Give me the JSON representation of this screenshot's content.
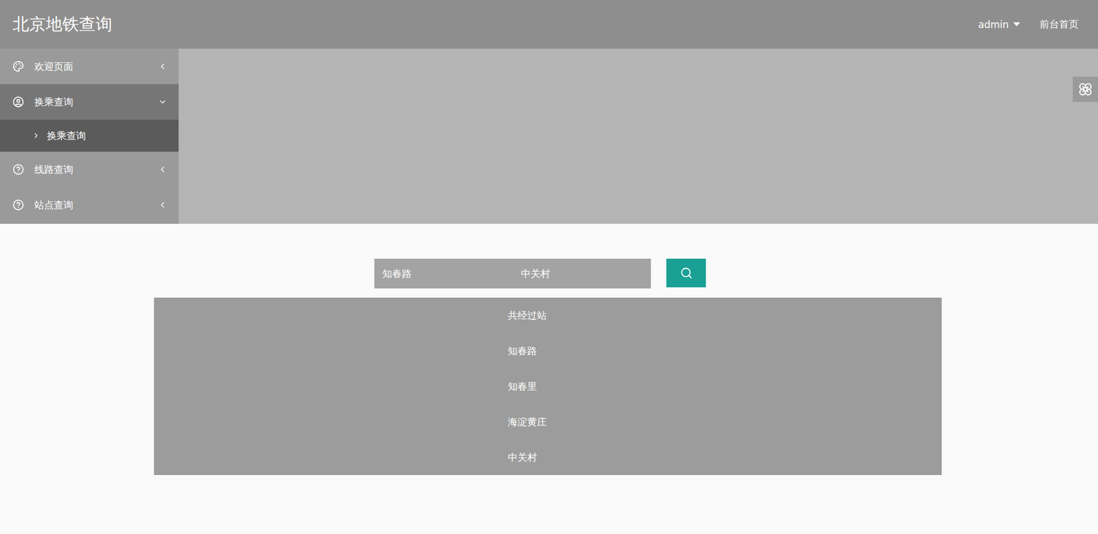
{
  "header": {
    "title": "北京地铁查询",
    "user": "admin",
    "link": "前台首页"
  },
  "sidebar": {
    "items": [
      {
        "label": "欢迎页面",
        "selected": false,
        "expanded": false,
        "children": []
      },
      {
        "label": "换乘查询",
        "selected": true,
        "expanded": true,
        "children": [
          {
            "label": "换乘查询",
            "selected": true
          }
        ]
      },
      {
        "label": "线路查询",
        "selected": false,
        "expanded": false,
        "children": []
      },
      {
        "label": "站点查询",
        "selected": false,
        "expanded": false,
        "children": []
      }
    ]
  },
  "search": {
    "from": "知春路",
    "to": "中关村"
  },
  "result": {
    "summary": "共经过站",
    "stations": [
      "知春路",
      "知春里",
      "海淀黄庄",
      "中关村"
    ]
  }
}
